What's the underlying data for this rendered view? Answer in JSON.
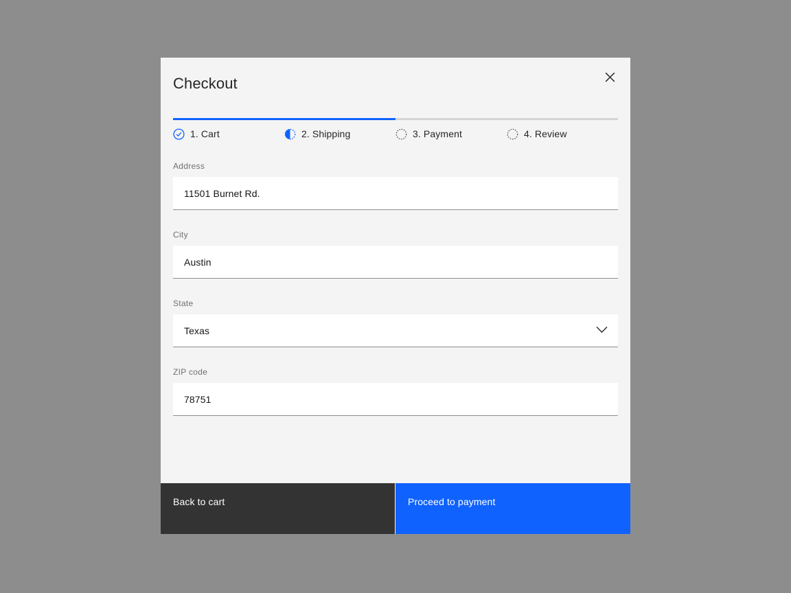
{
  "modal": {
    "title": "Checkout",
    "close_icon": "close-icon"
  },
  "progress": {
    "fill_percent": 50,
    "accent_color": "#0f62fe",
    "track_color": "#d4d4d4",
    "steps": [
      {
        "label": "1. Cart",
        "state": "complete",
        "icon": "checkmark-circle-icon"
      },
      {
        "label": "2. Shipping",
        "state": "current",
        "icon": "half-circle-icon"
      },
      {
        "label": "3. Payment",
        "state": "incomplete",
        "icon": "dotted-circle-icon"
      },
      {
        "label": "4. Review",
        "state": "incomplete",
        "icon": "dotted-circle-icon"
      }
    ]
  },
  "form": {
    "fields": [
      {
        "label": "Address",
        "value": "11501 Burnet Rd.",
        "placeholder": "",
        "type": "text"
      },
      {
        "label": "City",
        "value": "Austin",
        "placeholder": "",
        "type": "text"
      },
      {
        "label": "State",
        "value": "Texas",
        "placeholder": "",
        "type": "select",
        "icon": "chevron-down-icon"
      },
      {
        "label": "ZIP code",
        "value": "78751",
        "placeholder": "",
        "type": "text"
      }
    ]
  },
  "footer": {
    "secondary_label": "Back to cart",
    "primary_label": "Proceed to payment",
    "secondary_color": "#333333",
    "primary_color": "#0f62fe"
  },
  "colors": {
    "backdrop": "#8d8d8d",
    "surface": "#f4f4f4",
    "field_bg": "#ffffff",
    "field_border": "#8d8d8d",
    "text": "#161616",
    "muted_text": "#6f6f6f"
  }
}
